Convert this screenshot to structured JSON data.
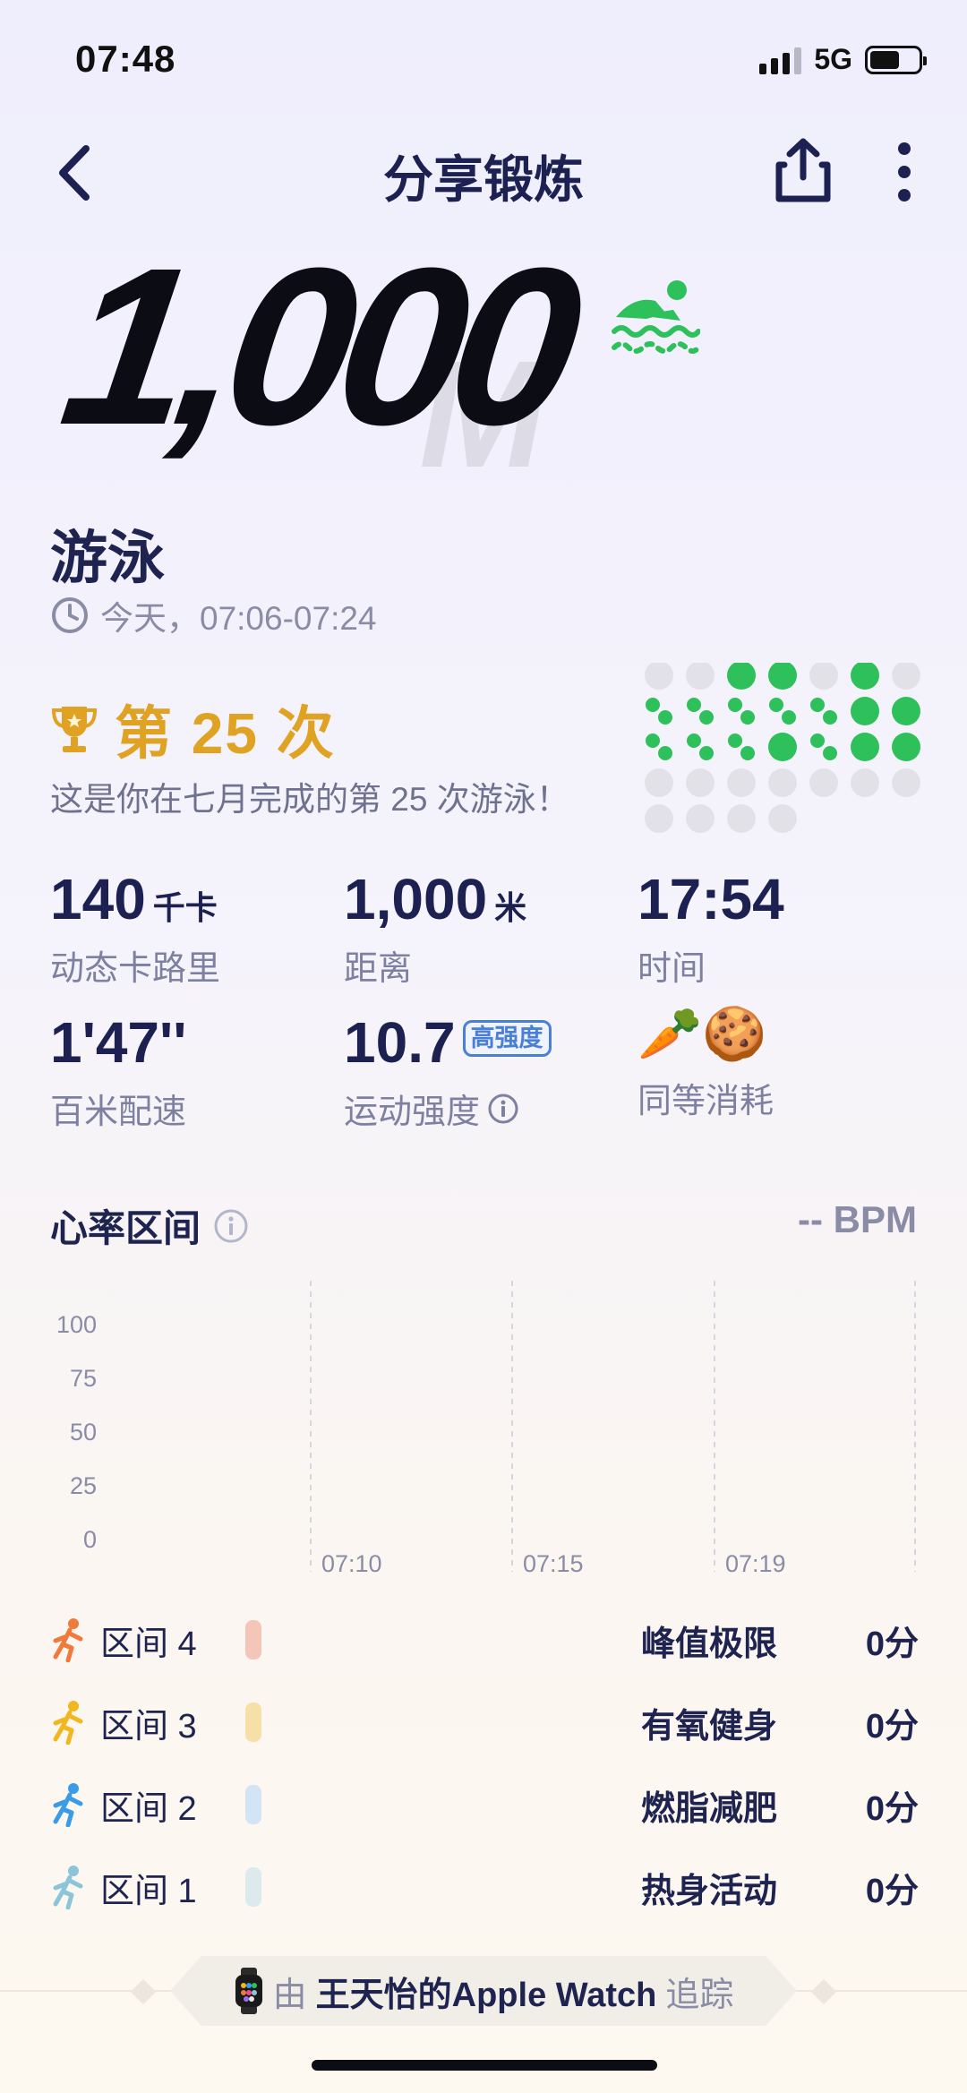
{
  "status_bar": {
    "time": "07:48",
    "network": "5G"
  },
  "nav": {
    "title": "分享锻炼"
  },
  "hero": {
    "value": "1,000",
    "unit": "M"
  },
  "activity": {
    "name": "游泳",
    "time_range": "今天，07:06-07:24"
  },
  "achievement": {
    "label": "第 25 次",
    "description": "这是你在七月完成的第 25 次游泳！"
  },
  "stats": {
    "calories": {
      "value": "140",
      "unit": "千卡",
      "label": "动态卡路里"
    },
    "distance": {
      "value": "1,000",
      "unit": "米",
      "label": "距离"
    },
    "duration": {
      "value": "17:54",
      "label": "时间"
    },
    "pace": {
      "value": "1'47''",
      "label": "百米配速"
    },
    "intensity": {
      "value": "10.7",
      "badge": "高强度",
      "label": "运动强度"
    },
    "equivalent": {
      "emojis": "🥕🍪",
      "label": "同等消耗"
    }
  },
  "heart_rate": {
    "title": "心率区间",
    "bpm": "-- BPM",
    "y_ticks": [
      "100",
      "75",
      "50",
      "25",
      "0"
    ],
    "x_ticks": [
      "07:10",
      "07:15",
      "07:19"
    ]
  },
  "zones": [
    {
      "name": "区间 4",
      "category": "峰值极限",
      "value": "0分",
      "color": "#f4c6b8",
      "icon_color": "#f07a3a"
    },
    {
      "name": "区间 3",
      "category": "有氧健身",
      "value": "0分",
      "color": "#f7e0a8",
      "icon_color": "#f0b71f"
    },
    {
      "name": "区间 2",
      "category": "燃脂减肥",
      "value": "0分",
      "color": "#d3e4f5",
      "icon_color": "#3a9be8"
    },
    {
      "name": "区间 1",
      "category": "热身活动",
      "value": "0分",
      "color": "#dceaee",
      "icon_color": "#8cc4d8"
    }
  ],
  "footer": {
    "prefix": "由",
    "device": "王天怡的Apple Watch",
    "suffix": "追踪"
  },
  "colors": {
    "accent_gold": "#e0a223",
    "swim_green": "#2ec05a",
    "text_dark": "#1d2152",
    "text_muted": "#7d80a0"
  }
}
